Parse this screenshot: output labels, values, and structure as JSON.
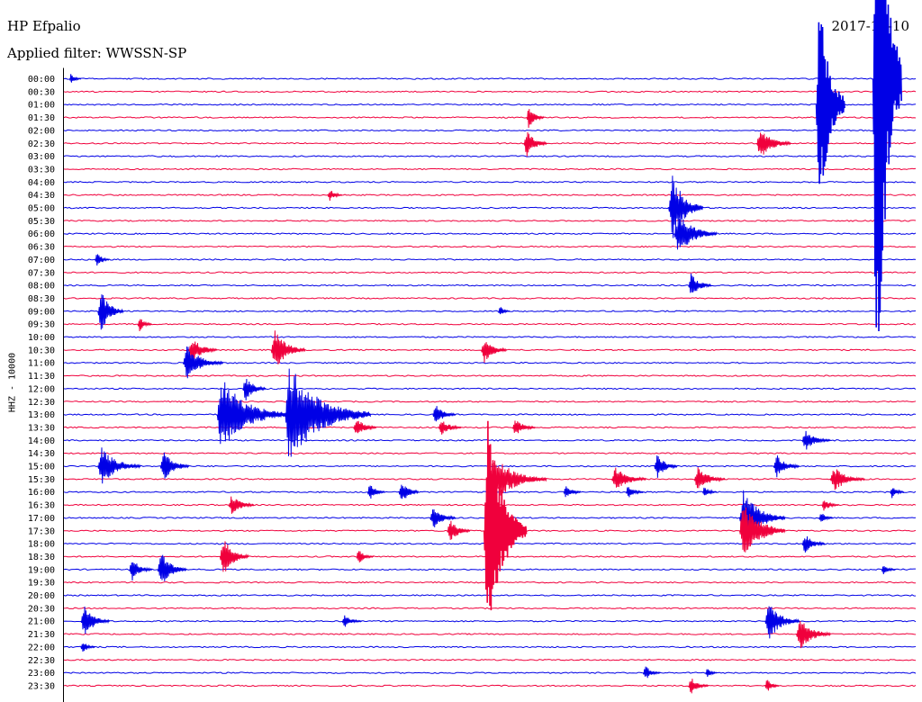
{
  "header": {
    "station": "HP Efpalio",
    "filter": "Applied filter: WWSSN-SP",
    "date": "2017-12-10"
  },
  "colors": {
    "blue": "#0000e6",
    "red": "#f0003c",
    "axis": "#000000",
    "background": "#ffffff"
  },
  "chart_data": {
    "type": "line",
    "title": "HP Efpalio",
    "subtitle": "Applied filter: WWSSN-SP",
    "date": "2017-12-10",
    "xlabel": "",
    "ylabel": "HHZ - 10000",
    "row_labels": [
      "00:00",
      "00:30",
      "01:00",
      "01:30",
      "02:00",
      "02:30",
      "03:00",
      "03:30",
      "04:00",
      "04:30",
      "05:00",
      "05:30",
      "06:00",
      "06:30",
      "07:00",
      "07:30",
      "08:00",
      "08:30",
      "09:00",
      "09:30",
      "10:00",
      "10:30",
      "11:00",
      "11:30",
      "12:00",
      "12:30",
      "13:00",
      "13:30",
      "14:00",
      "14:30",
      "15:00",
      "15:30",
      "16:00",
      "16:30",
      "17:00",
      "17:30",
      "18:00",
      "18:30",
      "19:00",
      "19:30",
      "20:00",
      "20:30",
      "21:00",
      "21:30",
      "22:00",
      "22:30",
      "23:00",
      "23:30"
    ],
    "row_color_cycle": [
      "blue",
      "red"
    ],
    "x_minutes_per_row": 30,
    "grid": false,
    "events_note": "offset_min = minutes after row start; amp = relative peak amplitude (1 = row spacing)",
    "events": [
      {
        "row": 0,
        "offset_min": 0.2,
        "amp": 0.4,
        "duration_min": 0.4
      },
      {
        "row": 0,
        "offset_min": 28.5,
        "amp": 28,
        "duration_min": 1.0
      },
      {
        "row": 2,
        "offset_min": 26.5,
        "amp": 9,
        "duration_min": 1.0
      },
      {
        "row": 3,
        "offset_min": 16.3,
        "amp": 0.9,
        "duration_min": 0.6
      },
      {
        "row": 5,
        "offset_min": 16.2,
        "amp": 1.1,
        "duration_min": 0.8
      },
      {
        "row": 5,
        "offset_min": 24.4,
        "amp": 1.2,
        "duration_min": 1.2
      },
      {
        "row": 9,
        "offset_min": 9.3,
        "amp": 0.5,
        "duration_min": 0.5
      },
      {
        "row": 10,
        "offset_min": 21.3,
        "amp": 2.7,
        "duration_min": 1.2
      },
      {
        "row": 12,
        "offset_min": 21.5,
        "amp": 1.7,
        "duration_min": 1.5
      },
      {
        "row": 14,
        "offset_min": 1.1,
        "amp": 0.6,
        "duration_min": 0.5
      },
      {
        "row": 16,
        "offset_min": 22.0,
        "amp": 1.0,
        "duration_min": 0.8
      },
      {
        "row": 18,
        "offset_min": 1.2,
        "amp": 1.6,
        "duration_min": 0.9
      },
      {
        "row": 18,
        "offset_min": 15.3,
        "amp": 0.5,
        "duration_min": 0.4
      },
      {
        "row": 19,
        "offset_min": 2.6,
        "amp": 0.6,
        "duration_min": 0.5
      },
      {
        "row": 21,
        "offset_min": 4.4,
        "amp": 1.0,
        "duration_min": 1.0
      },
      {
        "row": 21,
        "offset_min": 7.3,
        "amp": 1.6,
        "duration_min": 1.2
      },
      {
        "row": 21,
        "offset_min": 14.7,
        "amp": 1.0,
        "duration_min": 0.9
      },
      {
        "row": 22,
        "offset_min": 4.2,
        "amp": 1.4,
        "duration_min": 1.4
      },
      {
        "row": 24,
        "offset_min": 6.3,
        "amp": 1.0,
        "duration_min": 0.8
      },
      {
        "row": 26,
        "offset_min": 5.4,
        "amp": 3.0,
        "duration_min": 2.5
      },
      {
        "row": 26,
        "offset_min": 7.8,
        "amp": 4.0,
        "duration_min": 3.0
      },
      {
        "row": 26,
        "offset_min": 13.0,
        "amp": 0.8,
        "duration_min": 0.8
      },
      {
        "row": 27,
        "offset_min": 10.2,
        "amp": 0.8,
        "duration_min": 0.8
      },
      {
        "row": 27,
        "offset_min": 13.2,
        "amp": 0.7,
        "duration_min": 0.8
      },
      {
        "row": 27,
        "offset_min": 15.8,
        "amp": 0.7,
        "duration_min": 0.8
      },
      {
        "row": 28,
        "offset_min": 26.0,
        "amp": 0.8,
        "duration_min": 1.0
      },
      {
        "row": 30,
        "offset_min": 1.2,
        "amp": 1.5,
        "duration_min": 1.5
      },
      {
        "row": 30,
        "offset_min": 3.4,
        "amp": 1.2,
        "duration_min": 1.0
      },
      {
        "row": 30,
        "offset_min": 20.8,
        "amp": 1.0,
        "duration_min": 0.8
      },
      {
        "row": 30,
        "offset_min": 25.0,
        "amp": 0.9,
        "duration_min": 0.9
      },
      {
        "row": 31,
        "offset_min": 15.0,
        "amp": 2.0,
        "duration_min": 2.0
      },
      {
        "row": 31,
        "offset_min": 19.3,
        "amp": 1.0,
        "duration_min": 1.2
      },
      {
        "row": 31,
        "offset_min": 22.2,
        "amp": 1.0,
        "duration_min": 1.1
      },
      {
        "row": 31,
        "offset_min": 27.0,
        "amp": 1.0,
        "duration_min": 1.2
      },
      {
        "row": 32,
        "offset_min": 10.7,
        "amp": 0.7,
        "duration_min": 0.6
      },
      {
        "row": 32,
        "offset_min": 11.8,
        "amp": 1.0,
        "duration_min": 0.7
      },
      {
        "row": 32,
        "offset_min": 17.6,
        "amp": 0.6,
        "duration_min": 0.6
      },
      {
        "row": 32,
        "offset_min": 19.8,
        "amp": 0.6,
        "duration_min": 0.6
      },
      {
        "row": 32,
        "offset_min": 22.5,
        "amp": 0.5,
        "duration_min": 0.5
      },
      {
        "row": 32,
        "offset_min": 29.1,
        "amp": 0.5,
        "duration_min": 0.5
      },
      {
        "row": 33,
        "offset_min": 5.8,
        "amp": 0.8,
        "duration_min": 0.9
      },
      {
        "row": 33,
        "offset_min": 26.7,
        "amp": 0.5,
        "duration_min": 0.6
      },
      {
        "row": 34,
        "offset_min": 12.9,
        "amp": 0.9,
        "duration_min": 0.9
      },
      {
        "row": 34,
        "offset_min": 23.8,
        "amp": 2.2,
        "duration_min": 1.6
      },
      {
        "row": 34,
        "offset_min": 26.6,
        "amp": 0.5,
        "duration_min": 0.5
      },
      {
        "row": 35,
        "offset_min": 13.5,
        "amp": 1.0,
        "duration_min": 0.8
      },
      {
        "row": 35,
        "offset_min": 14.8,
        "amp": 9,
        "duration_min": 1.5
      },
      {
        "row": 35,
        "offset_min": 23.8,
        "amp": 2.5,
        "duration_min": 1.6
      },
      {
        "row": 36,
        "offset_min": 26.0,
        "amp": 0.8,
        "duration_min": 0.8
      },
      {
        "row": 37,
        "offset_min": 5.5,
        "amp": 1.5,
        "duration_min": 1.0
      },
      {
        "row": 37,
        "offset_min": 10.3,
        "amp": 0.6,
        "duration_min": 0.6
      },
      {
        "row": 38,
        "offset_min": 2.3,
        "amp": 0.9,
        "duration_min": 0.8
      },
      {
        "row": 38,
        "offset_min": 3.3,
        "amp": 1.4,
        "duration_min": 1.0
      },
      {
        "row": 38,
        "offset_min": 28.8,
        "amp": 0.4,
        "duration_min": 0.5
      },
      {
        "row": 42,
        "offset_min": 0.6,
        "amp": 1.2,
        "duration_min": 1.0
      },
      {
        "row": 42,
        "offset_min": 9.8,
        "amp": 0.5,
        "duration_min": 0.7
      },
      {
        "row": 42,
        "offset_min": 24.7,
        "amp": 1.5,
        "duration_min": 1.2
      },
      {
        "row": 43,
        "offset_min": 25.8,
        "amp": 1.4,
        "duration_min": 1.2
      },
      {
        "row": 44,
        "offset_min": 0.6,
        "amp": 0.5,
        "duration_min": 0.5
      },
      {
        "row": 46,
        "offset_min": 20.4,
        "amp": 0.6,
        "duration_min": 0.6
      },
      {
        "row": 46,
        "offset_min": 22.6,
        "amp": 0.4,
        "duration_min": 0.4
      },
      {
        "row": 47,
        "offset_min": 22.0,
        "amp": 0.7,
        "duration_min": 0.7
      },
      {
        "row": 47,
        "offset_min": 24.7,
        "amp": 0.6,
        "duration_min": 0.5
      }
    ]
  }
}
